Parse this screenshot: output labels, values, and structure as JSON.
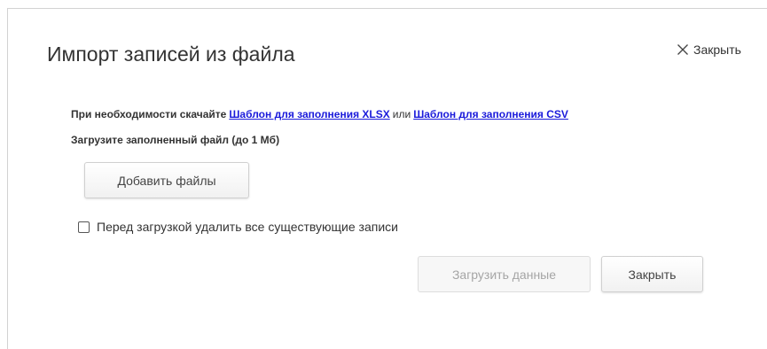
{
  "dialog": {
    "title": "Импорт записей из файла",
    "close_link_label": "Закрыть",
    "close_icon": "close-icon"
  },
  "info": {
    "prefix": "При необходимости скачайте",
    "template_xlsx_link": "Шаблон для заполнения XLSX",
    "or_text": "или",
    "template_csv_link": "Шаблон для заполнения CSV",
    "size_note": "Загрузите заполненный файл (до 1 Мб)"
  },
  "buttons": {
    "add_files": "Добавить файлы",
    "load_data": "Загрузить данные",
    "close": "Закрыть"
  },
  "checkbox": {
    "label": "Перед загрузкой удалить все существующие записи",
    "checked": false
  },
  "colors": {
    "link": "#1a1adb",
    "text": "#333333",
    "disabled_text": "#a5a5a5"
  }
}
